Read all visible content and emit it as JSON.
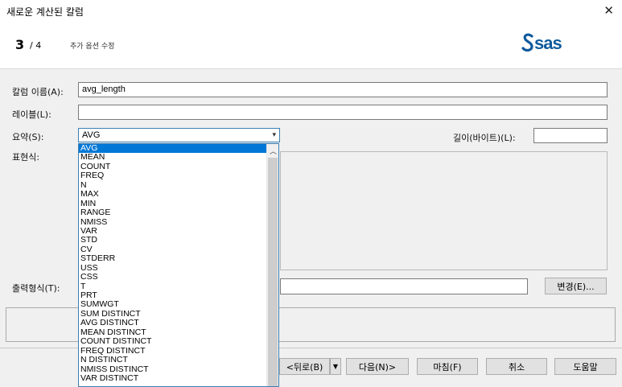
{
  "window": {
    "title": "새로운 계산된 칼럼"
  },
  "header": {
    "step_current": "3",
    "step_total": "/ 4",
    "step_desc": "추가 옵션 수정",
    "logo": "sas"
  },
  "form": {
    "column_name_label": "칼럼 이름(A):",
    "column_name_value": "avg_length",
    "label_label": "레이블(L):",
    "label_value": "",
    "summary_label": "요약(S):",
    "summary_value": "AVG",
    "length_label": "길이(바이트)(L):",
    "length_value": "",
    "expression_label": "표현식:",
    "format_label": "출력형식(T):",
    "change_button": "변경(E)..."
  },
  "dropdown": {
    "items": [
      "AVG",
      "MEAN",
      "COUNT",
      "FREQ",
      "N",
      "MAX",
      "MIN",
      "RANGE",
      "NMISS",
      "VAR",
      "STD",
      "CV",
      "STDERR",
      "USS",
      "CSS",
      "T",
      "PRT",
      "SUMWGT",
      "SUM DISTINCT",
      "AVG DISTINCT",
      "MEAN DISTINCT",
      "COUNT DISTINCT",
      "FREQ DISTINCT",
      "N DISTINCT",
      "NMISS DISTINCT",
      "VAR DISTINCT"
    ],
    "selected_index": 0
  },
  "footer": {
    "back": "<뒤로(B)",
    "next": "다음(N)>",
    "finish": "마침(F)",
    "cancel": "취소",
    "help": "도움말"
  },
  "colors": {
    "accent": "#0078d7",
    "logo": "#0f5a9c"
  }
}
